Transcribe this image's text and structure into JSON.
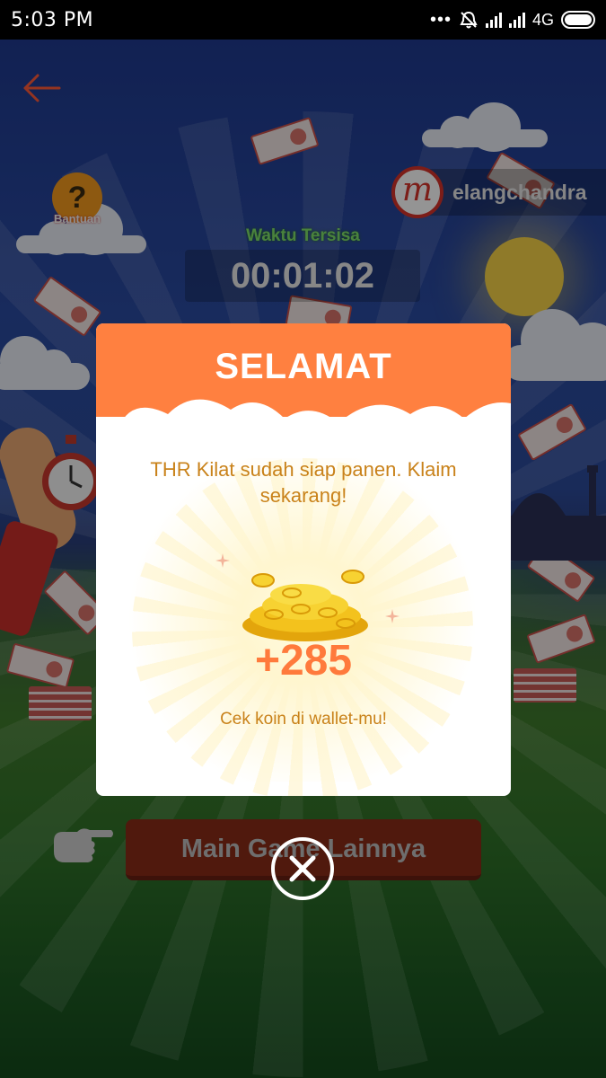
{
  "status_bar": {
    "time": "5:03 PM",
    "network": "4G",
    "icons": [
      "more-dots-icon",
      "alarm-off-icon",
      "signal-icon",
      "signal-icon",
      "battery-icon"
    ]
  },
  "header": {
    "back_icon": "back-arrow-icon",
    "help_label": "Bantuan",
    "help_icon": "question-icon",
    "username": "elangchandra",
    "avatar_letter": "m"
  },
  "timer": {
    "title": "Waktu Tersisa",
    "value": "00:01:02"
  },
  "modal": {
    "title": "SELAMAT",
    "message": "THR Kilat sudah siap panen. Klaim sekarang!",
    "amount": "+285",
    "note": "Cek koin di wallet-mu!",
    "close_icon": "close-icon"
  },
  "footer": {
    "main_button_label": "Main Game Lainnya",
    "pointer_icon": "pointing-hand-icon"
  },
  "colors": {
    "header_orange": "#ff8040",
    "amount_orange": "#ff7a3c",
    "text_gold": "#c9821a",
    "sky_blue": "#1f3a8f",
    "grass_green": "#2f7128"
  }
}
